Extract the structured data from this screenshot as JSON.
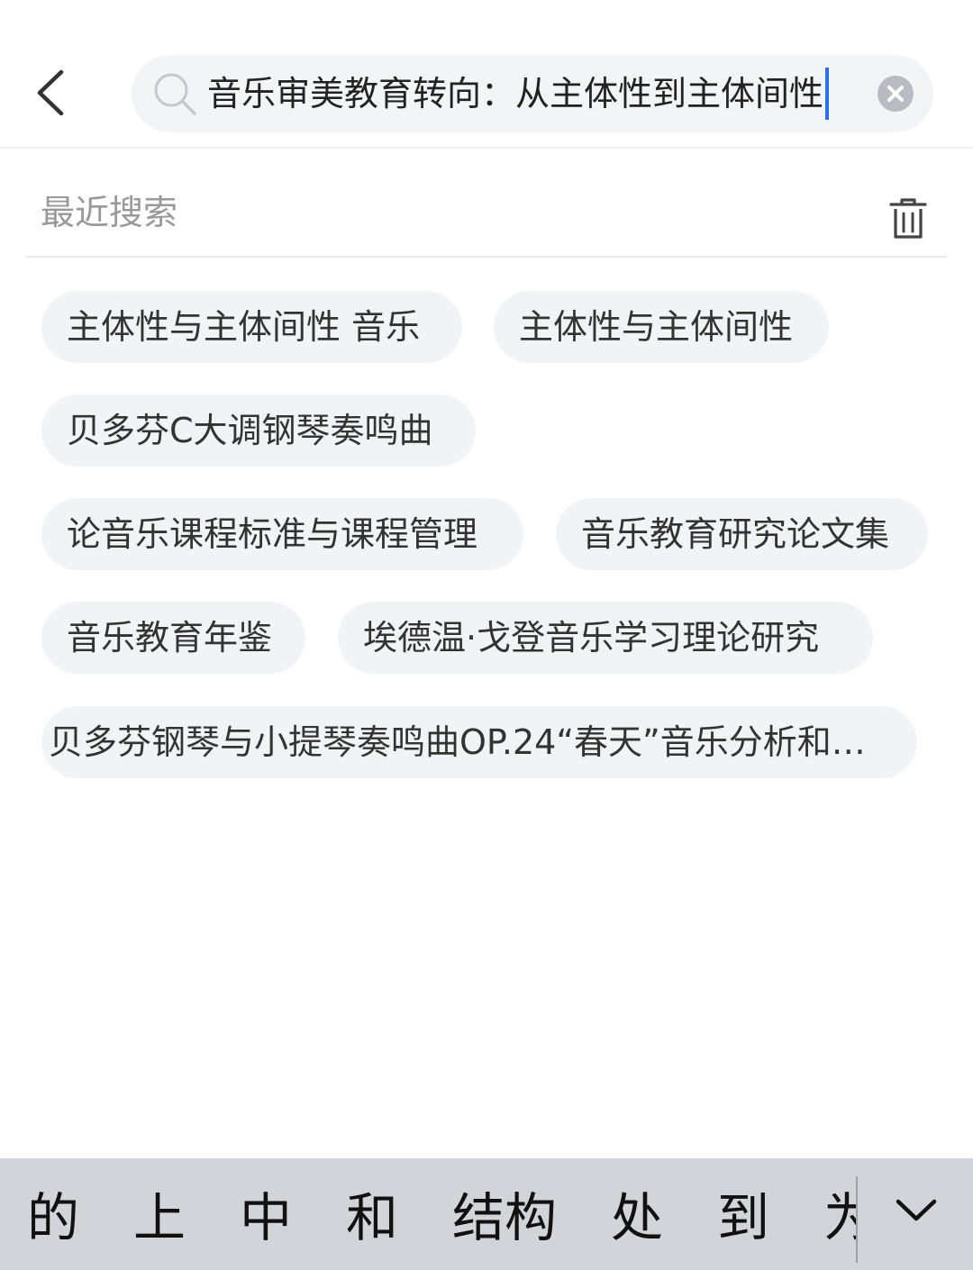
{
  "search": {
    "query": "音乐审美教育转向：从主体性到主体间性",
    "accent_color": "#2a6df4"
  },
  "icons": {
    "back": "chevron-left-icon",
    "search": "magnifier-icon",
    "clear": "close-circle-icon",
    "trash": "trash-icon",
    "collapse": "chevron-down-icon"
  },
  "recent": {
    "title": "最近搜索",
    "items": [
      "主体性与主体间性 音乐",
      "主体性与主体间性",
      "贝多芬C大调钢琴奏鸣曲",
      "论音乐课程标准与课程管理",
      "音乐教育研究论文集",
      "音乐教育年鉴",
      "埃德温·戈登音乐学习理论研究",
      "贝多芬钢琴与小提琴奏鸣曲OP.24“春天”音乐分析和…"
    ]
  },
  "ime": {
    "candidates": [
      "的",
      "上",
      "中",
      "和",
      "结构",
      "处",
      "到",
      "为"
    ]
  }
}
